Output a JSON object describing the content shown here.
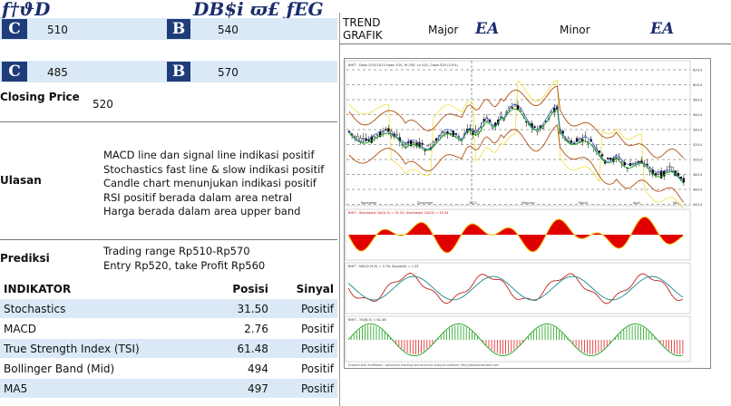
{
  "header": {
    "left_glyph": "ƒ†ϑD",
    "mid_glyph": "DΒ$i ϖ£ ƒEG"
  },
  "levels": {
    "support1": {
      "icon_glyph": "C",
      "value": "510"
    },
    "resistance1": {
      "icon_glyph": "B",
      "value": "540"
    },
    "support2": {
      "icon_glyph": "C",
      "value": "485"
    },
    "resistance2": {
      "icon_glyph": "B",
      "value": "570"
    }
  },
  "closing": {
    "label": "Closing Price",
    "value": "520"
  },
  "ulasan": {
    "label": "Ulasan",
    "lines": [
      "MACD line dan signal line indikasi positif",
      "Stochastics fast line & slow indikasi positif",
      "Candle chart menunjukan indikasi positif",
      "RSI positif berada dalam area netral",
      "Harga berada dalam area upper band"
    ]
  },
  "prediksi": {
    "label": "Prediksi",
    "lines": [
      "Trading range Rp510-Rp570",
      "Entry Rp520, take Profit Rp560"
    ]
  },
  "indicators": {
    "headers": [
      "INDIKATOR",
      "Posisi",
      "Sinyal"
    ],
    "rows": [
      {
        "name": "Stochastics",
        "posisi": "31.50",
        "sinyal": "Positif"
      },
      {
        "name": "MACD",
        "posisi": "2.76",
        "sinyal": "Positif"
      },
      {
        "name": "True Strength Index (TSI)",
        "posisi": "61.48",
        "sinyal": "Positif"
      },
      {
        "name": "Bollinger Band (Mid)",
        "posisi": "494",
        "sinyal": "Positif"
      },
      {
        "name": "MA5",
        "posisi": "497",
        "sinyal": "Positif"
      }
    ]
  },
  "trend": {
    "label": "TREND GRAFIK",
    "major_label": "Major",
    "major_glyph": "EA",
    "minor_label": "Minor",
    "minor_glyph": "EA"
  },
  "chart": {
    "main_caption": "BHIT - Daily 5/10/2013 Open 510, Hi 530, Lo 510, Close 520 (0.0%)",
    "price_ticks": [
      "620.0",
      "600.0",
      "580.0",
      "560.0",
      "540.0",
      "520.0",
      "500.0",
      "480.0",
      "460.0",
      "440.0"
    ],
    "months": [
      "November",
      "December",
      "2013",
      "February",
      "March",
      "April",
      "May"
    ],
    "stoch_caption": "BHIT - Stochastic %K(5,3) = 31.50, Stochastic %D(3) = 33.54",
    "macd_caption": "BHIT - MACD (6,9) = 2.76, Signal(6) = 1.23",
    "tsi_caption": "BHIT - TSI(6,3) = 61.48",
    "footer": "Created with AmiBroker - advanced charting and technical analysis software. http://www.amibroker.com",
    "colors": {
      "candle_up": "#ffffff",
      "candle_down": "#000000",
      "ma": "#22aa22",
      "band": "#b05010",
      "sar": "#f0e040"
    }
  }
}
